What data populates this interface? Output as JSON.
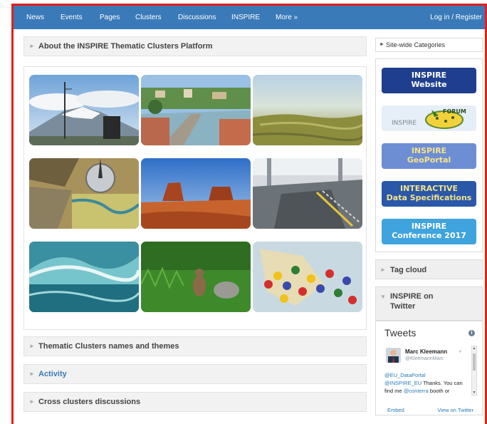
{
  "nav": {
    "items": [
      "News",
      "Events",
      "Pages",
      "Clusters",
      "Discussions",
      "INSPIRE",
      "More »"
    ],
    "login": "Log in / Register"
  },
  "panels": {
    "about": "About the INSPIRE Thematic Clusters Platform",
    "thematic": "Thematic Clusters names and themes",
    "activity": "Activity",
    "cross": "Cross clusters discussions"
  },
  "gallery": [
    {
      "icon": "weather-station-volcano-photo"
    },
    {
      "icon": "town-bridge-photo"
    },
    {
      "icon": "wetland-aerial-photo"
    },
    {
      "icon": "geology-compass-photo"
    },
    {
      "icon": "desert-butte-photo"
    },
    {
      "icon": "industrial-facility-photo"
    },
    {
      "icon": "ocean-wave-photo"
    },
    {
      "icon": "squirrel-grass-photo"
    },
    {
      "icon": "map-pawns-photo"
    }
  ],
  "sidebar": {
    "categories": "Site-wide Categories",
    "banners": [
      {
        "line1": "INSPIRE",
        "line2": "Website",
        "bg": "#1f3f8e",
        "fg": "#ffffff"
      },
      {
        "line1": "INSPIRE",
        "line2": "FORUM",
        "bg": "#e6eef7",
        "fg": "#7d8894"
      },
      {
        "line1": "INSPIRE",
        "line2": "GeoPortal",
        "bg": "#6e8ed4",
        "fg": "#f3e38a"
      },
      {
        "line1": "INTERACTIVE",
        "line2": "Data Specifications",
        "bg": "#2a57a8",
        "fg": "#f3e38a"
      },
      {
        "line1": "INSPIRE",
        "line2": "Conference 2017",
        "bg": "#3fa3dd",
        "fg": "#ffffff"
      }
    ],
    "tag_cloud": "Tag cloud",
    "twitter_title_line1": "INSPIRE on",
    "twitter_title_line2": "Twitter"
  },
  "tweets": {
    "header": "Tweets",
    "info": "i",
    "user_name": "Marc Kleemann",
    "user_handle": "@KleemannMarc",
    "text_mention1": "@EU_DataPortal",
    "text_mention2": "@INSPIRE_EU",
    "text_part1": " Thanks. You can find me ",
    "text_mention3": "@conterra",
    "text_part2": " booth or",
    "embed": "Embed",
    "view": "View on Twitter"
  },
  "colors": {
    "nav_bg": "#3a7ab8",
    "frame_border": "#e3201b",
    "link": "#3a7ab8"
  }
}
